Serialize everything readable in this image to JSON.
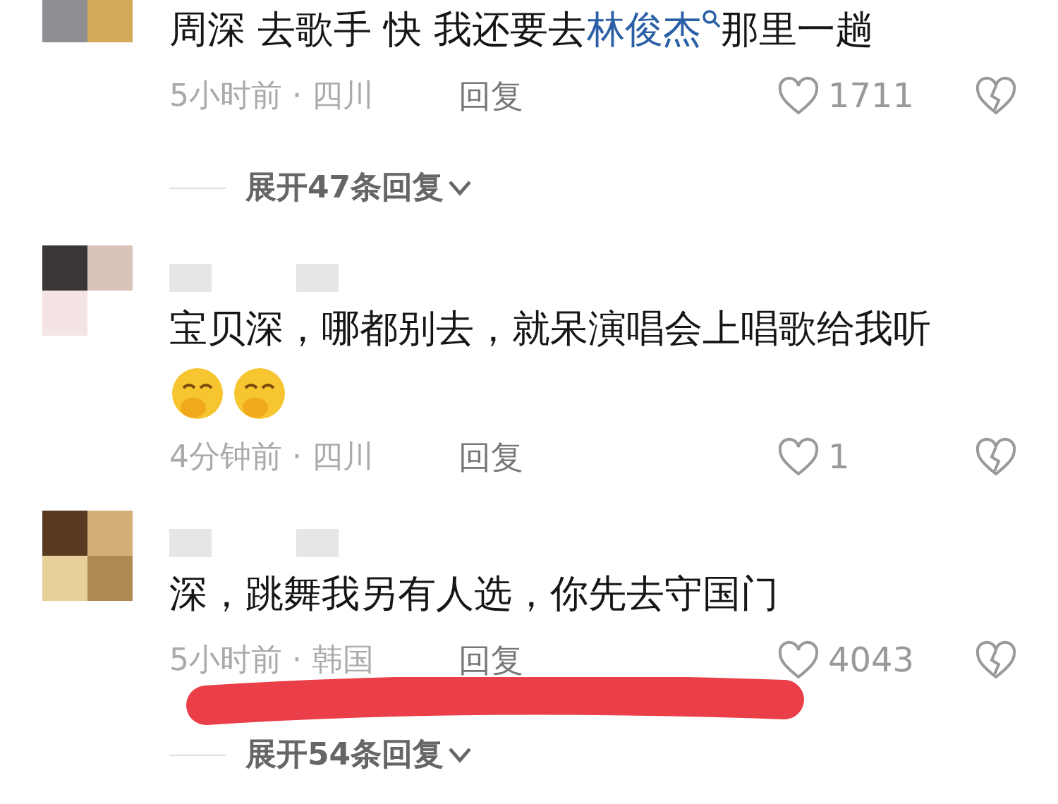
{
  "comments": [
    {
      "name_blurred": false,
      "segments": [
        {
          "kind": "text",
          "text": "周深 去歌手 快 我还要去"
        },
        {
          "kind": "link",
          "text": "林俊杰"
        },
        {
          "kind": "text",
          "text": "那里一趟"
        }
      ],
      "time_location": "5小时前 · 四川",
      "reply": "回复",
      "likes": "1711",
      "expand": "展开47条回复",
      "marker": false
    },
    {
      "name_blurred": true,
      "segments": [
        {
          "kind": "text",
          "text": "宝贝深，哪都别去，就呆演唱会上唱歌给我听"
        },
        {
          "kind": "emoji"
        },
        {
          "kind": "emoji"
        }
      ],
      "time_location": "4分钟前 · 四川",
      "reply": "回复",
      "likes": "1",
      "marker": false
    },
    {
      "name_blurred": true,
      "segments": [
        {
          "kind": "text",
          "text": "深，跳舞我另有人选，你先去守国门"
        }
      ],
      "time_location": "5小时前 · 韩国",
      "reply": "回复",
      "likes": "4043",
      "expand": "展开54条回复",
      "marker": true
    }
  ]
}
